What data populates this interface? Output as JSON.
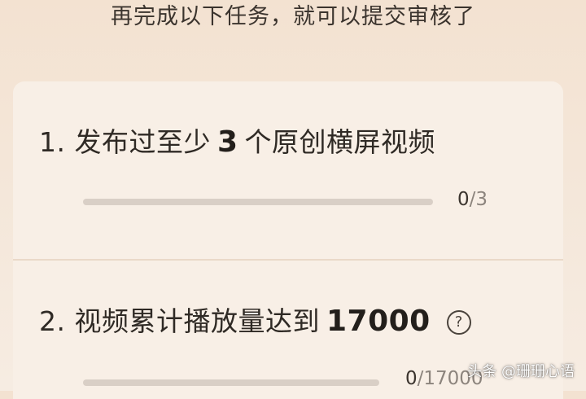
{
  "header": {
    "text": "再完成以下任务，就可以提交审核了"
  },
  "tasks": [
    {
      "prefix": "1. 发布过至少",
      "number": "3",
      "suffix": "个原创横屏视频",
      "progress_current": "0",
      "progress_total": "/3",
      "progress_fraction": 0
    },
    {
      "prefix": "2. 视频累计播放量达到",
      "number": "17000",
      "help_icon": "?",
      "progress_current": "0",
      "progress_total": "/17000",
      "progress_fraction": 0
    }
  ],
  "watermark": {
    "text": "头条 @珊珊心语"
  },
  "colors": {
    "track": "#d9cfc6",
    "fill": "#e4573a",
    "card": "#f8efe6"
  }
}
